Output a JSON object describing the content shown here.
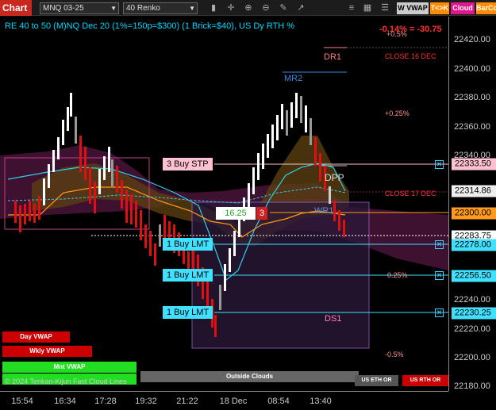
{
  "toolbar": {
    "chart_tab": "Chart",
    "instrument": "MNQ 03-25",
    "bar_type": "40 Renko",
    "icons": [
      "bars-icon",
      "crosshair-icon",
      "zoom-in-icon",
      "zoom-out-icon",
      "draw-icon",
      "cursor-icon",
      "properties-icon",
      "strategy-icon"
    ],
    "btn_wvwap": "W VWAP",
    "btn_tk": "T<>K",
    "btn_cloud": "Cloud",
    "btn_barco": "BarCo"
  },
  "header": {
    "title": "RE 40 to 50 (M)NQ Dec 20 (1%=150p=$300) (1 Brick=$40), US Dy RTH %",
    "pct_change": "-0.14% = -30.75"
  },
  "levels": {
    "dr1": "DR1",
    "mr2": "MR2",
    "dpp": "DPP",
    "wr1": "WR1",
    "ds1": "DS1",
    "close_16": "CLOSE 16 DEC",
    "close_17": "CLOSE 17 DEC",
    "pct_05": "+0.5%",
    "pct_025": "+0.25%",
    "pct_n025": "0.25%",
    "pct_n05": "-0.5%"
  },
  "orders": {
    "buy_stp": "3 Buy STP",
    "buy_lmt_1": "1 Buy LMT",
    "buy_lmt_2": "1 Buy LMT",
    "buy_lmt_3": "1 Buy LMT",
    "position_price": "16.25",
    "position_qty": "3"
  },
  "legend": {
    "day_vwap": "Day VWAP",
    "wkly_vwap": "Wkly VWAP",
    "mnt_vwap": "Mnt VWAP",
    "outside_clouds": "Outside Clouds",
    "us_eth_or": "US ETH OR",
    "us_rth_or": "US RTH OR",
    "copyright": "© 2024 Tenkan-Kijun Fast Cloud Lines"
  },
  "price_axis": {
    "ticks": [
      "22420.00",
      "22400.00",
      "22380.00",
      "22360.00",
      "22340.00",
      "22320.00",
      "22300.00",
      "22280.00",
      "22260.00",
      "22240.00",
      "22220.00",
      "22200.00",
      "22180.00"
    ],
    "tag_stp": "22333.50",
    "tag_last": "22314.86",
    "tag_pos": "22300.00",
    "tag_cur": "22283.75",
    "tag_lmt1": "22278.00",
    "tag_lmt2": "22256.50",
    "tag_lmt3": "22230.25"
  },
  "time_axis": {
    "ticks": [
      "15:54",
      "16:34",
      "17:28",
      "19:32",
      "21:22",
      "18 Dec",
      "08:54",
      "13:40"
    ]
  },
  "colors": {
    "up": "#ffffff",
    "down": "#e01010",
    "cloud_pink": "#5a1a40",
    "cloud_orange": "#5a3a10",
    "vwap": "#00c8e0",
    "kijun": "#ff9a1a"
  }
}
